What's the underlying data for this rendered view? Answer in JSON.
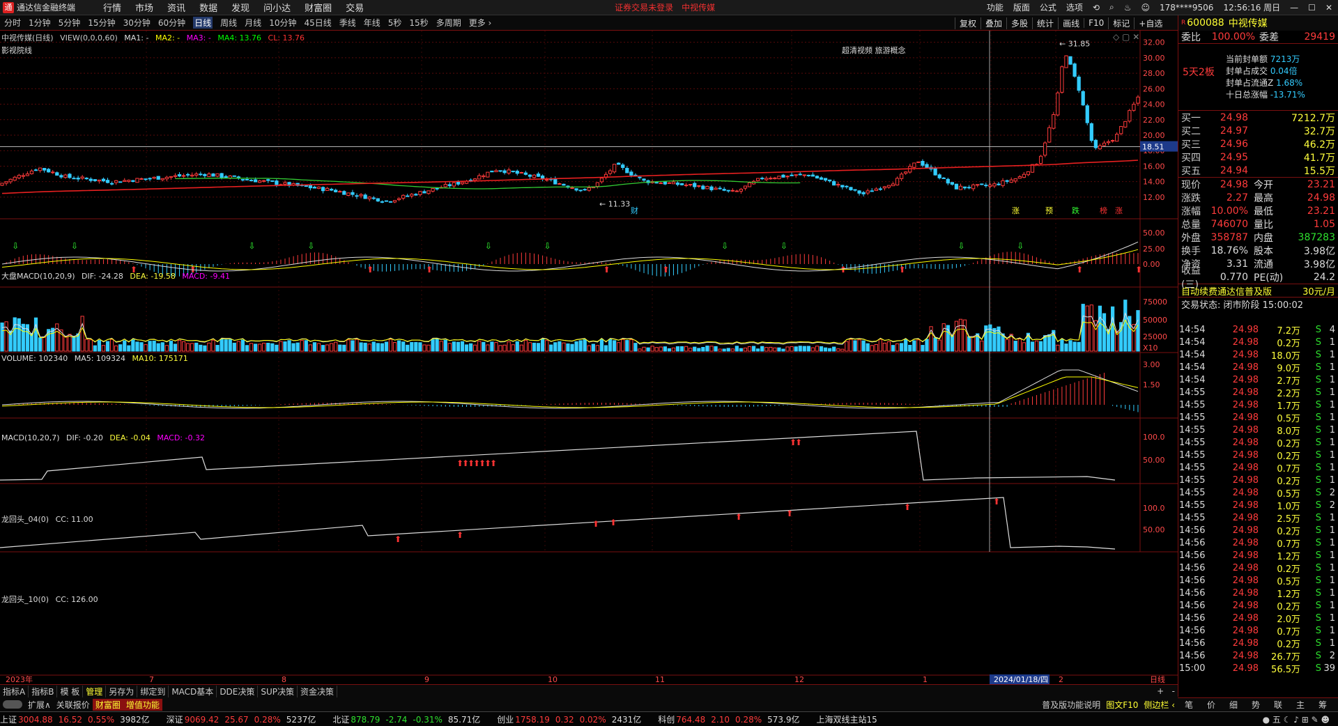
{
  "window": {
    "app_name": "通达信金融终端",
    "menus": [
      "行情",
      "市场",
      "资讯",
      "数据",
      "发现",
      "问小达",
      "财富圈",
      "交易"
    ],
    "warn": "证券交易未登录",
    "warn2": "中视传媒",
    "right_items": [
      "功能",
      "版面",
      "公式",
      "选项"
    ],
    "user": "178****9506",
    "clock": "12:56:16 周日"
  },
  "periods": [
    "分时",
    "1分钟",
    "5分钟",
    "15分钟",
    "30分钟",
    "60分钟",
    "日线",
    "周线",
    "月线",
    "10分钟",
    "45日线",
    "季线",
    "年线",
    "5秒",
    "15秒",
    "多周期",
    "更多 ›"
  ],
  "active_period": "日线",
  "tools": [
    "复权",
    "叠加",
    "多股",
    "统计",
    "画线",
    "F10",
    "标记",
    "+自选"
  ],
  "chart_head": {
    "name": "中视传媒(日线)",
    "view": "VIEW(0,0,0,60)",
    "ma1": "MA1: -",
    "ma2": "MA2: -",
    "ma3": "MA3: -",
    "ma4": "MA4: 13.76",
    "cl": "CL: 13.76",
    "sub": "影视院线",
    "concepts": "超清视频 旅游概念",
    "high_label": "31.85",
    "low_label": "11.33",
    "cross_price": "18.51",
    "cai": "财",
    "markers": [
      "涨",
      "预",
      "跌",
      "榜",
      "涨"
    ]
  },
  "axes": {
    "price": [
      "32.00",
      "30.00",
      "28.00",
      "26.00",
      "24.00",
      "22.00",
      "20.00",
      "18.00",
      "16.00",
      "14.00",
      "12.00"
    ],
    "macd1": [
      "50.00",
      "25.00",
      "0.00"
    ],
    "vol": [
      "75000",
      "50000",
      "25000",
      "X10"
    ],
    "macd2": [
      "3.00",
      "1.50"
    ],
    "lht4": [
      "100.0",
      "50.00"
    ],
    "lht10": [
      "100.0",
      "50.00"
    ]
  },
  "indicators": {
    "macd1": {
      "name": "大盘MACD(10,20,9)",
      "dif": "DIF: -24.28",
      "dea": "DEA: -19.58",
      "macd": "MACD: -9.41"
    },
    "vol": {
      "name": "VOLUME: 102340",
      "ma5": "MA5: 109324",
      "ma10": "MA10: 175171"
    },
    "macd2": {
      "name": "MACD(10,20,7)",
      "dif": "DIF: -0.20",
      "dea": "DEA: -0.04",
      "macd": "MACD: -0.32"
    },
    "lht4": {
      "name": "龙回头_04(0)",
      "cc": "CC: 11.00"
    },
    "lht10": {
      "name": "龙回头_10(0)",
      "cc": "CC: 126.00"
    }
  },
  "xaxis": {
    "labels": [
      "2023年",
      "7",
      "8",
      "9",
      "10",
      "11",
      "12",
      "1",
      "2024/01/18/四",
      "2",
      "日线"
    ]
  },
  "quote": {
    "code": "600088",
    "name": "中视传媒",
    "weibi_label": "委比",
    "weibi": "100.00%",
    "weicha_label": "委差",
    "weicha": "29419",
    "board": "5天2板",
    "seal": [
      {
        "k": "当前封单额",
        "v": "7213万"
      },
      {
        "k": "封单占成交",
        "v": "0.04倍"
      },
      {
        "k": "封单占流通Z",
        "v": "1.68%"
      },
      {
        "k": "十日总涨幅",
        "v": "-13.71%"
      }
    ],
    "bids": [
      {
        "l": "买一",
        "p": "24.98",
        "v": "7212.7万"
      },
      {
        "l": "买二",
        "p": "24.97",
        "v": "32.7万"
      },
      {
        "l": "买三",
        "p": "24.96",
        "v": "46.2万"
      },
      {
        "l": "买四",
        "p": "24.95",
        "v": "41.7万"
      },
      {
        "l": "买五",
        "p": "24.94",
        "v": "15.5万"
      }
    ],
    "stats": [
      [
        "现价",
        "24.98",
        "今开",
        "23.21"
      ],
      [
        "涨跌",
        "2.27",
        "最高",
        "24.98"
      ],
      [
        "涨幅",
        "10.00%",
        "最低",
        "23.21"
      ],
      [
        "总量",
        "746070",
        "量比",
        "1.05"
      ],
      [
        "外盘",
        "358787",
        "内盘",
        "387283"
      ],
      [
        "换手",
        "18.76%",
        "股本",
        "3.98亿"
      ],
      [
        "净资",
        "3.31",
        "流通",
        "3.98亿"
      ],
      [
        "收益(三)",
        "0.770",
        "PE(动)",
        "24.2"
      ]
    ],
    "promo": "自动续费通达信普及版",
    "promo_price": "30元/月",
    "trade_state": "交易状态: 闭市阶段 15:00:02"
  },
  "ticks": [
    [
      "14:54",
      "24.98",
      "7.2万",
      "S",
      "4"
    ],
    [
      "14:54",
      "24.98",
      "0.2万",
      "S",
      "1"
    ],
    [
      "14:54",
      "24.98",
      "18.0万",
      "S",
      "1"
    ],
    [
      "14:54",
      "24.98",
      "9.0万",
      "S",
      "1"
    ],
    [
      "14:54",
      "24.98",
      "2.7万",
      "S",
      "1"
    ],
    [
      "14:55",
      "24.98",
      "2.2万",
      "S",
      "1"
    ],
    [
      "14:55",
      "24.98",
      "1.7万",
      "S",
      "1"
    ],
    [
      "14:55",
      "24.98",
      "0.5万",
      "S",
      "1"
    ],
    [
      "14:55",
      "24.98",
      "8.0万",
      "S",
      "1"
    ],
    [
      "14:55",
      "24.98",
      "0.2万",
      "S",
      "1"
    ],
    [
      "14:55",
      "24.98",
      "0.2万",
      "S",
      "1"
    ],
    [
      "14:55",
      "24.98",
      "0.7万",
      "S",
      "1"
    ],
    [
      "14:55",
      "24.98",
      "0.2万",
      "S",
      "1"
    ],
    [
      "14:55",
      "24.98",
      "0.5万",
      "S",
      "2"
    ],
    [
      "14:55",
      "24.98",
      "1.0万",
      "S",
      "2"
    ],
    [
      "14:55",
      "24.98",
      "2.5万",
      "S",
      "1"
    ],
    [
      "14:56",
      "24.98",
      "0.2万",
      "S",
      "1"
    ],
    [
      "14:56",
      "24.98",
      "0.7万",
      "S",
      "1"
    ],
    [
      "14:56",
      "24.98",
      "1.2万",
      "S",
      "1"
    ],
    [
      "14:56",
      "24.98",
      "0.2万",
      "S",
      "1"
    ],
    [
      "14:56",
      "24.98",
      "0.5万",
      "S",
      "1"
    ],
    [
      "14:56",
      "24.98",
      "1.2万",
      "S",
      "1"
    ],
    [
      "14:56",
      "24.98",
      "0.2万",
      "S",
      "1"
    ],
    [
      "14:56",
      "24.98",
      "2.0万",
      "S",
      "1"
    ],
    [
      "14:56",
      "24.98",
      "0.7万",
      "S",
      "1"
    ],
    [
      "14:56",
      "24.98",
      "0.2万",
      "S",
      "1"
    ],
    [
      "14:56",
      "24.98",
      "26.7万",
      "S",
      "2"
    ],
    [
      "15:00",
      "24.98",
      "56.5万",
      "S",
      "39"
    ]
  ],
  "bottom_tabs": [
    "指标A",
    "指标B",
    "模 板",
    "管理",
    "另存为",
    "绑定到",
    "MACD基本",
    "DDE决策",
    "SUP决策",
    "资金决策"
  ],
  "bottom_tabs2": [
    "扩展∧",
    "关联报价",
    "财富圈",
    "增值功能"
  ],
  "bottom_right": [
    "普及版功能说明",
    "图文F10",
    "侧边栏 ‹"
  ],
  "quote_tabs": [
    "笔",
    "价",
    "细",
    "势",
    "联",
    "主",
    "筹"
  ],
  "status": [
    {
      "k": "上证",
      "v": "3004.88",
      "c": "16.52",
      "p": "0.55%",
      "a": "3982亿"
    },
    {
      "k": "深证",
      "v": "9069.42",
      "c": "25.67",
      "p": "0.28%",
      "a": "5237亿"
    },
    {
      "k": "北证",
      "v": "878.79",
      "c": "-2.74",
      "p": "-0.31%",
      "a": "85.71亿"
    },
    {
      "k": "创业",
      "v": "1758.19",
      "c": "0.32",
      "p": "0.02%",
      "a": "2431亿"
    },
    {
      "k": "科创",
      "v": "764.48",
      "c": "2.10",
      "p": "0.28%",
      "a": "573.9亿"
    }
  ],
  "server": "上海双线主站15",
  "chart_data": {
    "type": "candlestick",
    "title": "中视传媒(日线)",
    "y_range": [
      11.33,
      31.85
    ],
    "recent_close": 24.98
  }
}
